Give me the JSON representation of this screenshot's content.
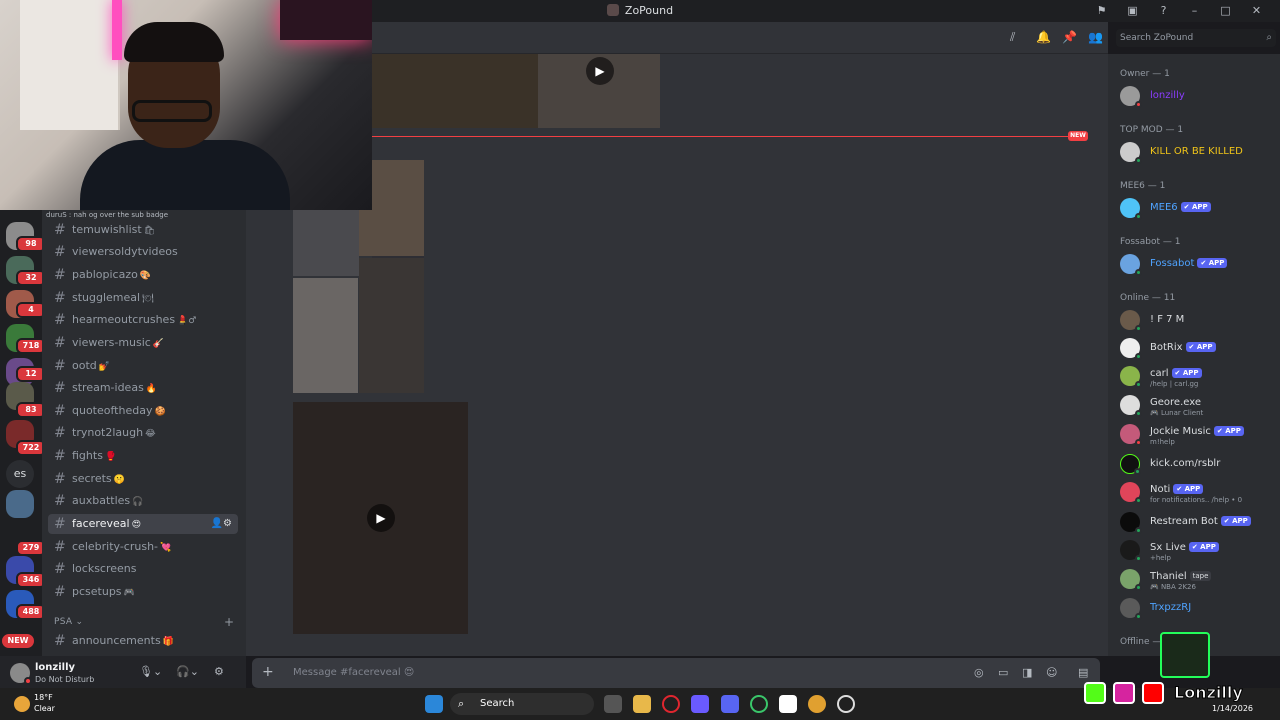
{
  "window": {
    "title": "ZoPound"
  },
  "header": {
    "search_placeholder": "Search ZoPound"
  },
  "server_badges": [
    "98",
    "32",
    "4",
    "718",
    "12",
    "83",
    "722",
    "279",
    "346",
    "488"
  ],
  "server_es_label": "es",
  "server_new_label": "NEW",
  "partial_message": "duruS : nah og over the sub badge",
  "channels": [
    {
      "name": "temuwishlist",
      "emoji": "🛍"
    },
    {
      "name": "viewersoldytvideos",
      "emoji": ""
    },
    {
      "name": "pablopicazo",
      "emoji": "🎨"
    },
    {
      "name": "stugglemeal",
      "emoji": "🍽"
    },
    {
      "name": "hearmeoutcrushes",
      "emoji": "💄♂"
    },
    {
      "name": "viewers-music",
      "emoji": "🎸"
    },
    {
      "name": "ootd",
      "emoji": "💅"
    },
    {
      "name": "stream-ideas",
      "emoji": "🔥"
    },
    {
      "name": "quoteoftheday",
      "emoji": "🍪"
    },
    {
      "name": "trynot2laugh",
      "emoji": "😂"
    },
    {
      "name": "fights",
      "emoji": "🥊"
    },
    {
      "name": "secrets",
      "emoji": "🤫"
    },
    {
      "name": "auxbattles",
      "emoji": "🎧"
    },
    {
      "name": "facereveal",
      "emoji": "😍"
    },
    {
      "name": "celebrity-crush-",
      "emoji": "💘"
    },
    {
      "name": "lockscreens",
      "emoji": ""
    },
    {
      "name": "pcsetups",
      "emoji": "🎮"
    }
  ],
  "category": {
    "name": "PSA",
    "channel": "announcements",
    "emoji": "🎁"
  },
  "user_panel": {
    "name": "lonzilly",
    "status": "Do Not Disturb"
  },
  "chat": {
    "new_label": "NEW",
    "composer_placeholder": "Message #facereveal 😍"
  },
  "members": {
    "groups": [
      {
        "label": "Owner — 1",
        "items": [
          {
            "name": "lonzilly",
            "sub": "",
            "app": false,
            "color": "#8b3dff"
          }
        ]
      },
      {
        "label": "TOP MOD — 1",
        "items": [
          {
            "name": "KILL OR BE KILLED",
            "sub": "",
            "app": false,
            "color": "#f0c419"
          }
        ]
      },
      {
        "label": "MEE6 — 1",
        "items": [
          {
            "name": "MEE6",
            "sub": "",
            "app": true,
            "color": "#4fa3ff"
          }
        ]
      },
      {
        "label": "Fossabot — 1",
        "items": [
          {
            "name": "Fossabot",
            "sub": "",
            "app": true,
            "color": "#4fa3ff"
          }
        ]
      },
      {
        "label": "Online — 11",
        "items": [
          {
            "name": "! F 7 M",
            "sub": "",
            "app": false,
            "color": "#dbdee1"
          },
          {
            "name": "BotRix",
            "sub": "",
            "app": true,
            "color": "#dbdee1"
          },
          {
            "name": "carl",
            "sub": "/help | carl.gg",
            "app": true,
            "color": "#dbdee1"
          },
          {
            "name": "Geore.exe",
            "sub": "🎮 Lunar Client",
            "app": false,
            "color": "#dbdee1"
          },
          {
            "name": "Jockie Music",
            "sub": "m!help",
            "app": true,
            "color": "#dbdee1"
          },
          {
            "name": "kick.com/rsblr",
            "sub": "",
            "app": false,
            "color": "#dbdee1"
          },
          {
            "name": "Noti",
            "sub": "for notifications.. /help • 0",
            "app": true,
            "color": "#dbdee1"
          },
          {
            "name": "Restream Bot",
            "sub": "",
            "app": true,
            "color": "#dbdee1"
          },
          {
            "name": "Sx Live",
            "sub": "+help",
            "app": true,
            "color": "#dbdee1"
          },
          {
            "name": "Thaniel",
            "sub": "🎮 NBA 2K26",
            "app": false,
            "tag": "tape",
            "color": "#dbdee1"
          },
          {
            "name": "TrxpzzRJ",
            "sub": "",
            "app": false,
            "color": "#4fa3ff"
          }
        ]
      },
      {
        "label": "Offline —",
        "items": []
      }
    ],
    "app_label": "✔ APP"
  },
  "taskbar": {
    "temp": "18°F",
    "condition": "Clear",
    "search_label": "Search",
    "date": "1/14/2026"
  },
  "overlay": {
    "name": "Lonzilly"
  }
}
